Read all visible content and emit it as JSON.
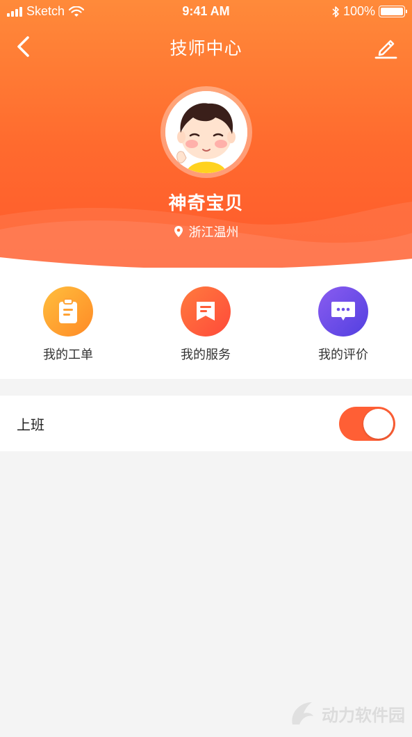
{
  "status_bar": {
    "carrier": "Sketch",
    "time": "9:41 AM",
    "battery": "100%"
  },
  "nav": {
    "title": "技师中心",
    "back_icon": "chevron-left-icon",
    "edit_icon": "pencil-icon"
  },
  "profile": {
    "name": "神奇宝贝",
    "location": "浙江温州",
    "location_icon": "map-pin-icon"
  },
  "actions": [
    {
      "label": "我的工单",
      "icon": "clipboard-icon",
      "color": "#ffa233"
    },
    {
      "label": "我的服务",
      "icon": "bookmark-card-icon",
      "color": "#ff5d38"
    },
    {
      "label": "我的评价",
      "icon": "chat-bubble-icon",
      "color": "#6b4fe8"
    }
  ],
  "work_toggle": {
    "label": "上班",
    "on": true
  },
  "watermark": {
    "text": "动力软件园"
  },
  "colors": {
    "header_top": "#ff8a3a",
    "header_bottom": "#ff5a2c",
    "switch_on": "#ff5f35",
    "background": "#f4f4f4"
  }
}
